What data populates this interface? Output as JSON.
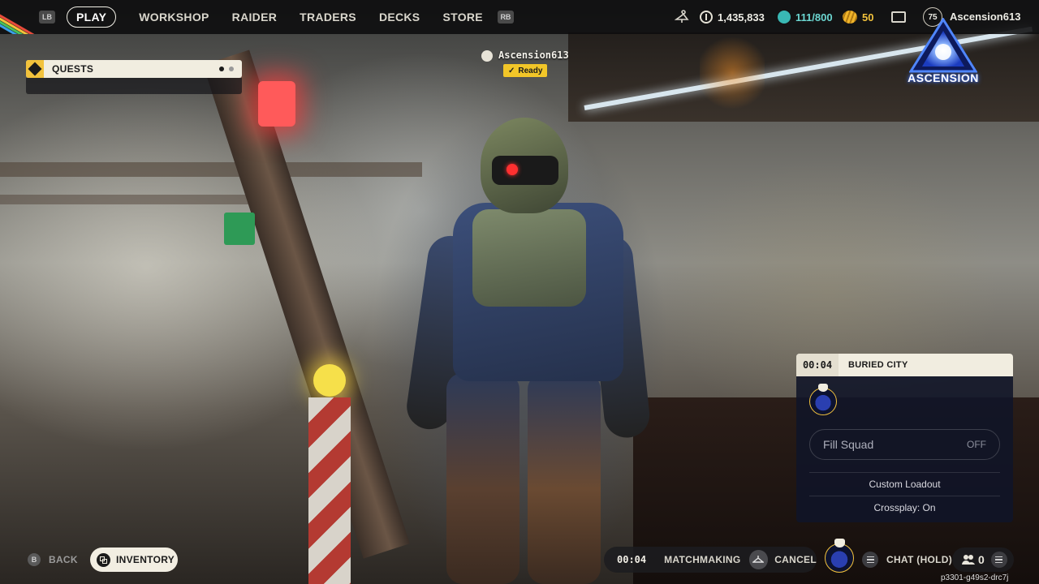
{
  "top_nav": {
    "lb_badge": "LB",
    "tabs": [
      {
        "label": "PLAY",
        "active": true
      },
      {
        "label": "WORKSHOP"
      },
      {
        "label": "RAIDER"
      },
      {
        "label": "TRADERS"
      },
      {
        "label": "DECKS"
      },
      {
        "label": "STORE"
      }
    ],
    "rb_badge": "RB"
  },
  "currencies": {
    "coins": "1,435,833",
    "creds": "111/800",
    "gold": "50"
  },
  "profile": {
    "level": "75",
    "username": "Ascension613"
  },
  "quests": {
    "label": "QUESTS"
  },
  "player_tag": {
    "name": "Ascension613",
    "status": "Ready"
  },
  "logo": {
    "text": "ASCENSION"
  },
  "match_panel": {
    "timer": "00:04",
    "map_name": "BURIED CITY",
    "fill_squad_label": "Fill Squad",
    "fill_squad_value": "OFF",
    "custom_loadout": "Custom Loadout",
    "crossplay": "Crossplay: On"
  },
  "bottom_bar": {
    "back_badge": "B",
    "back_label": "BACK",
    "inventory_label": "INVENTORY",
    "mm_timer": "00:04",
    "matchmaking_label": "MATCHMAKING",
    "cancel_label": "CANCEL",
    "chat_label": "CHAT (HOLD)",
    "friends_count": "0"
  },
  "build_id": "p3301-g49s2-drc7j",
  "colors": {
    "accent_yellow": "#f2c23c",
    "creds_teal": "#39b8b4",
    "logo_blue": "#3f7bff"
  }
}
